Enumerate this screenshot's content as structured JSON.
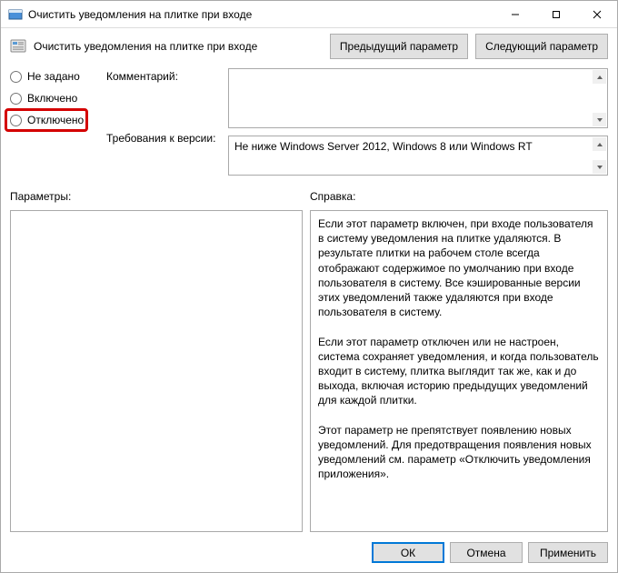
{
  "window": {
    "title": "Очистить уведомления на плитке при входе"
  },
  "header": {
    "title": "Очистить уведомления на плитке при входе",
    "prev_btn": "Предыдущий параметр",
    "next_btn": "Следующий параметр"
  },
  "radios": {
    "not_configured": "Не задано",
    "enabled": "Включено",
    "disabled": "Отключено"
  },
  "labels": {
    "comment": "Комментарий:",
    "requirements": "Требования к версии:",
    "params": "Параметры:",
    "help": "Справка:"
  },
  "fields": {
    "comment_value": "",
    "requirements_value": "Не ниже Windows Server 2012, Windows 8 или Windows RT"
  },
  "help_text": "Если этот параметр включен, при входе пользователя в систему уведомления на плитке удаляются. В результате плитки на рабочем столе всегда отображают содержимое по умолчанию при входе пользователя в систему. Все кэшированные версии этих уведомлений также удаляются при входе пользователя в систему.\n\nЕсли этот параметр отключен или не настроен, система сохраняет уведомления, и когда пользователь входит в систему, плитка выглядит так же, как и до выхода, включая историю предыдущих уведомлений для каждой плитки.\n\nЭтот параметр не препятствует появлению новых уведомлений. Для предотвращения появления новых уведомлений см. параметр «Отключить уведомления приложения».",
  "footer": {
    "ok": "ОК",
    "cancel": "Отмена",
    "apply": "Применить"
  }
}
